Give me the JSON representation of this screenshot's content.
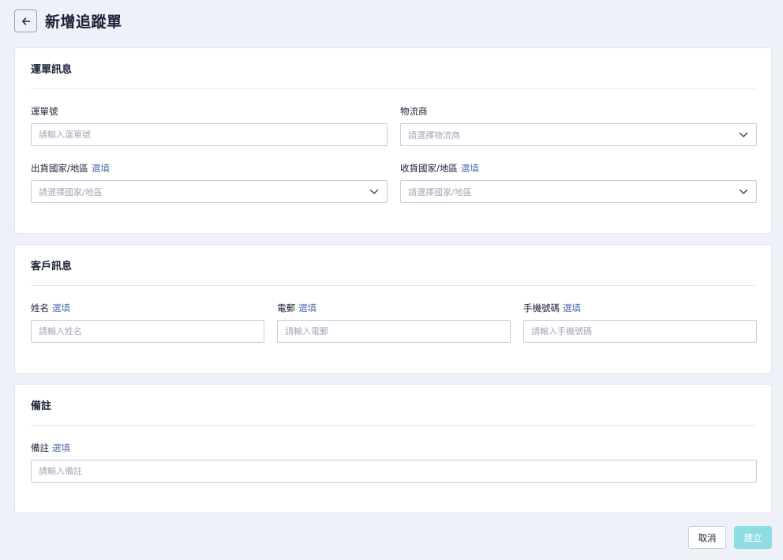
{
  "header": {
    "title": "新增追蹤單"
  },
  "sections": {
    "waybill": {
      "title": "運單訊息",
      "tracking_number": {
        "label": "運單號",
        "placeholder": "請輸入運單號"
      },
      "carrier": {
        "label": "物流商",
        "placeholder": "請選擇物流商"
      },
      "origin": {
        "label": "出貨國家/地區",
        "optional": "選填",
        "placeholder": "請選擇國家/地區"
      },
      "destination": {
        "label": "收貨國家/地區",
        "optional": "選填",
        "placeholder": "請選擇國家/地區"
      }
    },
    "customer": {
      "title": "客戶訊息",
      "name": {
        "label": "姓名",
        "optional": "選填",
        "placeholder": "請輸入姓名"
      },
      "email": {
        "label": "電郵",
        "optional": "選填",
        "placeholder": "請輸入電郵"
      },
      "phone": {
        "label": "手機號碼",
        "optional": "選填",
        "placeholder": "請輸入手機號碼"
      }
    },
    "notes": {
      "title": "備註",
      "note": {
        "label": "備註",
        "optional": "選填",
        "placeholder": "請輸入備註"
      }
    }
  },
  "actions": {
    "cancel_label": "取消",
    "create_label": "建立"
  },
  "icons": {
    "back": "arrow-left-icon",
    "dropdown": "chevron-down-icon"
  },
  "colors": {
    "background": "#eef1f8",
    "optional_text": "#4a6ea6",
    "primary_disabled": "#8fdde3"
  }
}
